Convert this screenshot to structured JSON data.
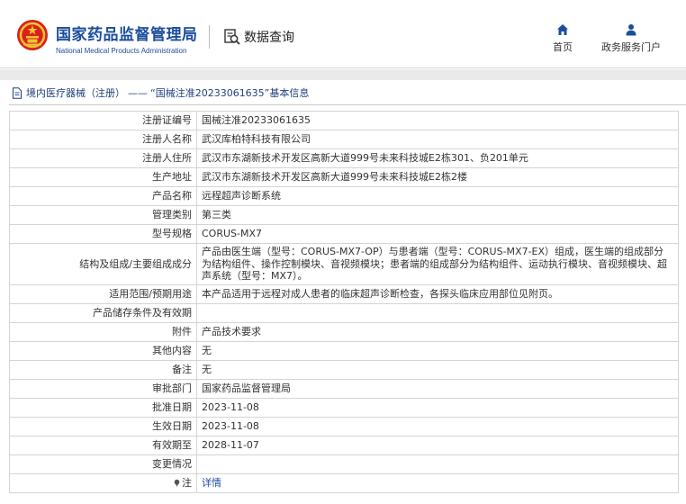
{
  "header": {
    "org_name_cn": "国家药品监督管理局",
    "org_name_en": "National Medical Products Administration",
    "data_query_label": "数据查询",
    "nav": {
      "home_label": "首页",
      "portal_label": "政务服务门户"
    }
  },
  "breadcrumb": {
    "category": "境内医疗器械（注册）",
    "separator": "——",
    "record_title": "“国械注准20233061635”基本信息"
  },
  "record": {
    "rows": [
      {
        "key": "注册证编号",
        "value": "国械注准20233061635"
      },
      {
        "key": "注册人名称",
        "value": "武汉库柏特科技有限公司"
      },
      {
        "key": "注册人住所",
        "value": "武汉市东湖新技术开发区高新大道999号未来科技城E2栋301、负201单元"
      },
      {
        "key": "生产地址",
        "value": "武汉市东湖新技术开发区高新大道999号未来科技城E2栋2楼"
      },
      {
        "key": "产品名称",
        "value": "远程超声诊断系统"
      },
      {
        "key": "管理类别",
        "value": "第三类"
      },
      {
        "key": "型号规格",
        "value": "CORUS-MX7"
      },
      {
        "key": "结构及组成/主要组成成分",
        "value": "产品由医生端（型号：CORUS-MX7-OP）与患者端（型号：CORUS-MX7-EX）组成，医生端的组成部分为结构组件、操作控制模块、音视频模块；患者端的组成部分为结构组件、运动执行模块、音视频模块、超声系统（型号：MX7）。"
      },
      {
        "key": "适用范围/预期用途",
        "value": "本产品适用于远程对成人患者的临床超声诊断检查，各探头临床应用部位见附页。"
      },
      {
        "key": "产品储存条件及有效期",
        "value": ""
      },
      {
        "key": "附件",
        "value": "产品技术要求"
      },
      {
        "key": "其他内容",
        "value": "无"
      },
      {
        "key": "备注",
        "value": "无"
      },
      {
        "key": "审批部门",
        "value": "国家药品监督管理局"
      },
      {
        "key": "批准日期",
        "value": "2023-11-08"
      },
      {
        "key": "生效日期",
        "value": "2023-11-08"
      },
      {
        "key": "有效期至",
        "value": "2028-11-07"
      },
      {
        "key": "变更情况",
        "value": ""
      }
    ],
    "note": {
      "key": "注",
      "link_label": "详情"
    }
  },
  "colors": {
    "brand_blue": "#1b4d9c",
    "emblem_red": "#d7221c",
    "emblem_gold": "#f1c232"
  },
  "icons": {
    "emblem": "national-emblem-icon",
    "query": "search-document-icon",
    "home": "home-icon",
    "portal": "user-icon",
    "breadcrumb": "document-icon",
    "note": "pin-icon"
  }
}
